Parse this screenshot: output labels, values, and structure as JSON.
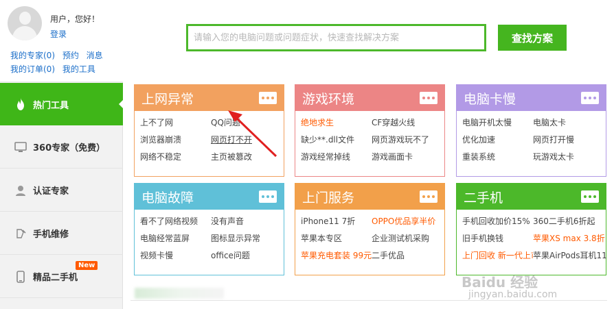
{
  "user": {
    "greeting": "用户，您好！",
    "login": "登录",
    "links_row1": [
      "我的专家(0)",
      "预约",
      "消息"
    ],
    "links_row2": [
      "我的订单(0)",
      "我的工具"
    ]
  },
  "nav": [
    {
      "label": "热门工具",
      "icon": "flame-icon",
      "active": true
    },
    {
      "label": "360专家（免费）",
      "icon": "monitor-icon",
      "active": false
    },
    {
      "label": "认证专家",
      "icon": "person-icon",
      "active": false
    },
    {
      "label": "手机维修",
      "icon": "wrench-icon",
      "active": false
    },
    {
      "label": "精品二手机",
      "icon": "phone-icon",
      "active": false,
      "badge": "New"
    }
  ],
  "search": {
    "placeholder": "请输入您的电脑问题或问题症状，快速查找解决方案",
    "button": "查找方案"
  },
  "cards": [
    {
      "title": "上网异常",
      "color": "#f2a15f",
      "links": [
        {
          "t": "上不了网"
        },
        {
          "t": "QQ问题"
        },
        {
          "t": "浏览器崩溃"
        },
        {
          "t": "网页打不开",
          "u": true
        },
        {
          "t": "网络不稳定"
        },
        {
          "t": "主页被篡改"
        }
      ]
    },
    {
      "title": "游戏环境",
      "color": "#ec8585",
      "links": [
        {
          "t": "绝地求生",
          "hot": true
        },
        {
          "t": "CF穿越火线"
        },
        {
          "t": "缺少**.dll文件"
        },
        {
          "t": "网页游戏玩不了"
        },
        {
          "t": "游戏经常掉线"
        },
        {
          "t": "游戏画面卡"
        }
      ]
    },
    {
      "title": "电脑卡慢",
      "color": "#b29ae6",
      "links": [
        {
          "t": "电脑开机太慢"
        },
        {
          "t": "电脑太卡"
        },
        {
          "t": "优化加速"
        },
        {
          "t": "网页打开慢"
        },
        {
          "t": "重装系统"
        },
        {
          "t": "玩游戏太卡"
        }
      ]
    },
    {
      "title": "电脑故障",
      "color": "#5fc0d8",
      "links": [
        {
          "t": "看不了网络视频"
        },
        {
          "t": "没有声音"
        },
        {
          "t": "电脑经常蓝屏"
        },
        {
          "t": "图标显示异常"
        },
        {
          "t": "视频卡慢"
        },
        {
          "t": "office问题"
        }
      ]
    },
    {
      "title": "上门服务",
      "color": "#f2a04a",
      "links": [
        {
          "t": "iPhone11 7折"
        },
        {
          "t": "OPPO优品享半价",
          "hot": true
        },
        {
          "t": "苹果本专区"
        },
        {
          "t": "企业测试机采购"
        },
        {
          "t": "苹果充电套装 99元",
          "hot": true
        },
        {
          "t": "二手优品"
        }
      ]
    },
    {
      "title": "二手机",
      "color": "#4cb82a",
      "links": [
        {
          "t": "手机回收加价15%"
        },
        {
          "t": "360二手机6折起"
        },
        {
          "t": "旧手机换钱"
        },
        {
          "t": "苹果XS max 3.8折",
          "hot": true
        },
        {
          "t": "上门回收 新一代上市",
          "hot": true
        },
        {
          "t": "苹果AirPods耳机11"
        }
      ]
    }
  ],
  "watermark": {
    "text": "Baidu 经验",
    "url": "jingyan.baidu.com"
  }
}
